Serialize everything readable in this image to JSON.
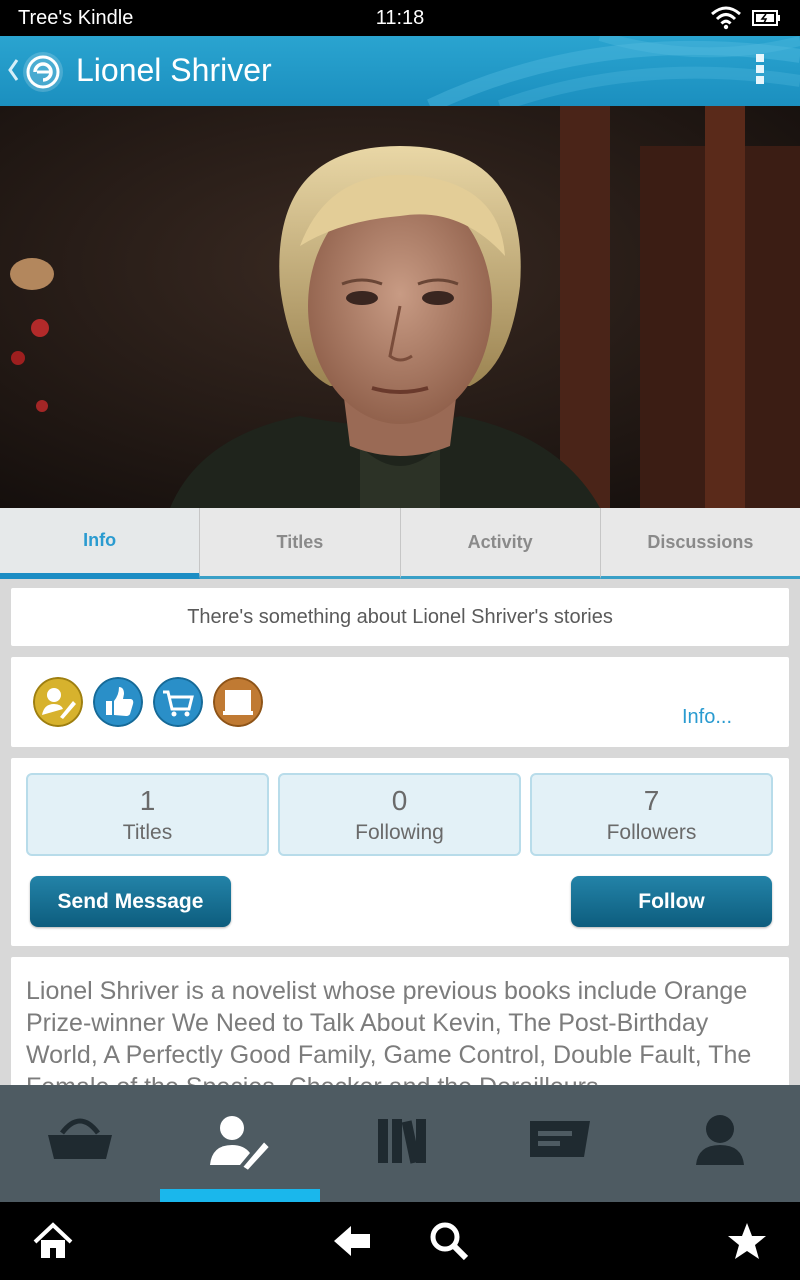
{
  "status_bar": {
    "device_name": "Tree's Kindle",
    "time": "11:18"
  },
  "action_bar": {
    "title": "Lionel Shriver",
    "back_icon": "chevron-left-icon",
    "logo_icon": "app-swirl-logo-icon",
    "menu_icon": "overflow-menu-icon"
  },
  "hero": {
    "image_alt": "author-photo"
  },
  "tabs": [
    {
      "label": "Info",
      "active": true
    },
    {
      "label": "Titles",
      "active": false
    },
    {
      "label": "Activity",
      "active": false
    },
    {
      "label": "Discussions",
      "active": false
    }
  ],
  "tagline": "There's something about Lionel Shriver's stories",
  "badges": {
    "items": [
      "author-pen-icon",
      "thumbs-up-icon",
      "shopping-cart-icon",
      "book-icon"
    ],
    "info_link": "Info..."
  },
  "stats": [
    {
      "value": "1",
      "label": "Titles"
    },
    {
      "value": "0",
      "label": "Following"
    },
    {
      "value": "7",
      "label": "Followers"
    }
  ],
  "actions": {
    "send_message": "Send Message",
    "follow": "Follow"
  },
  "bio": "Lionel Shriver is a novelist whose previous books include Orange Prize-winner We Need to Talk About Kevin, The Post-Birthday World, A Perfectly Good Family, Game Control, Double Fault, The Female of the Species, Checker and the Derailleurs",
  "bottom_nav": {
    "items": [
      "store-basket-icon",
      "authors-icon",
      "library-icon",
      "messages-icon",
      "profile-icon"
    ],
    "active_index": 1
  },
  "system_nav": [
    "home-icon",
    "back-arrow-icon",
    "search-icon",
    "favorites-star-icon"
  ],
  "colors": {
    "accent": "#1c8dc4",
    "action_bar": "#1b8fbf",
    "button": "#0d5d7e",
    "nav_bg": "#4e5b62",
    "nav_indicator": "#1ab7ec"
  }
}
